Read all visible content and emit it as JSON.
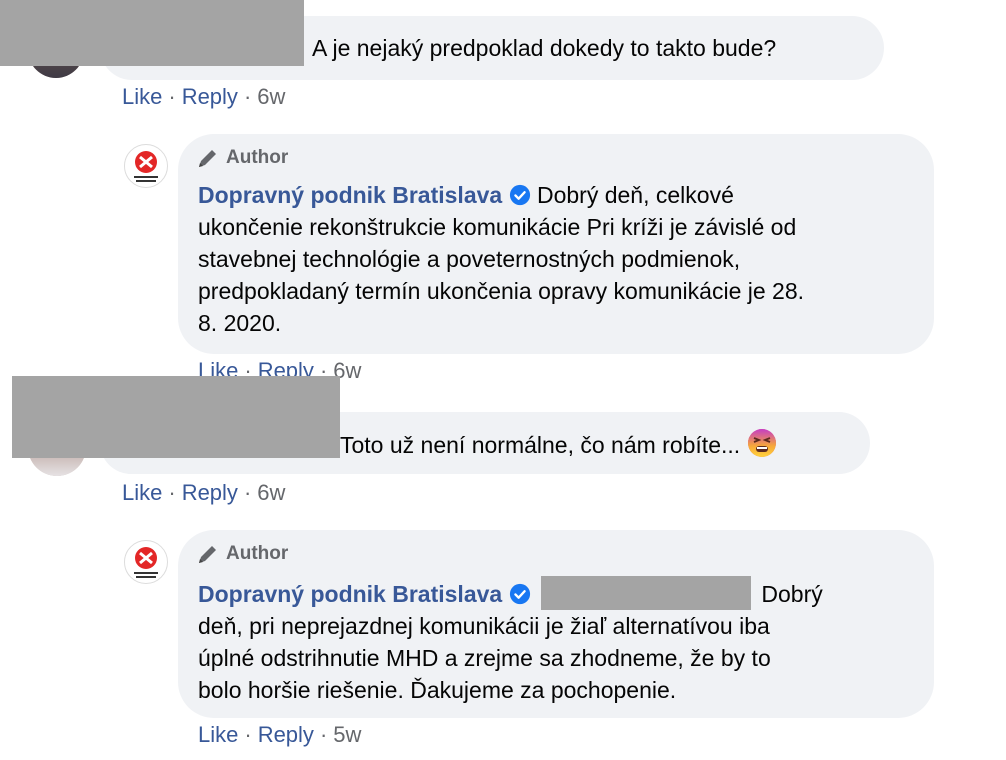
{
  "comments": [
    {
      "text": "A je nejaký predpoklad dokedy to takto bude?",
      "actions": {
        "like": "Like",
        "reply": "Reply",
        "time": "6w",
        "separator": "·"
      }
    },
    {
      "badge": "Author",
      "author": "Dopravný podnik Bratislava",
      "text_line1": "Dobrý deň, celkové",
      "text_line2": "ukončenie rekonštrukcie komunikácie Pri kríži je závislé od",
      "text_line3": "stavebnej technológie a poveternostných podmienok,",
      "text_line4": "predpokladaný termín ukončenia opravy komunikácie je 28.",
      "text_line5": "8. 2020.",
      "actions": {
        "like": "Like",
        "reply": "Reply",
        "time": "6w",
        "separator": "·"
      }
    },
    {
      "text": "Toto už není normálne, čo nám robíte...",
      "emoji": "persevering-face",
      "actions": {
        "like": "Like",
        "reply": "Reply",
        "time": "6w",
        "separator": "·"
      }
    },
    {
      "badge": "Author",
      "author": "Dopravný podnik Bratislava",
      "text_line1": "Dobrý",
      "text_line2": "deň, pri neprejazdnej komunikácii je žiaľ alternatívou iba",
      "text_line3": "úplné odstrihnutie MHD a zrejme sa zhodneme, že by to",
      "text_line4": "bolo horšie riešenie. Ďakujeme za pochopenie.",
      "actions": {
        "like": "Like",
        "reply": "Reply",
        "time": "5w",
        "separator": "·"
      }
    }
  ],
  "colors": {
    "bubble": "#f0f2f5",
    "link": "#385898",
    "muted": "#65676b",
    "verified": "#1877f2",
    "redaction": "#a4a4a4"
  },
  "icons": {
    "badge": "pen-icon",
    "verified": "verified-icon",
    "logo": "dpb-logo"
  }
}
